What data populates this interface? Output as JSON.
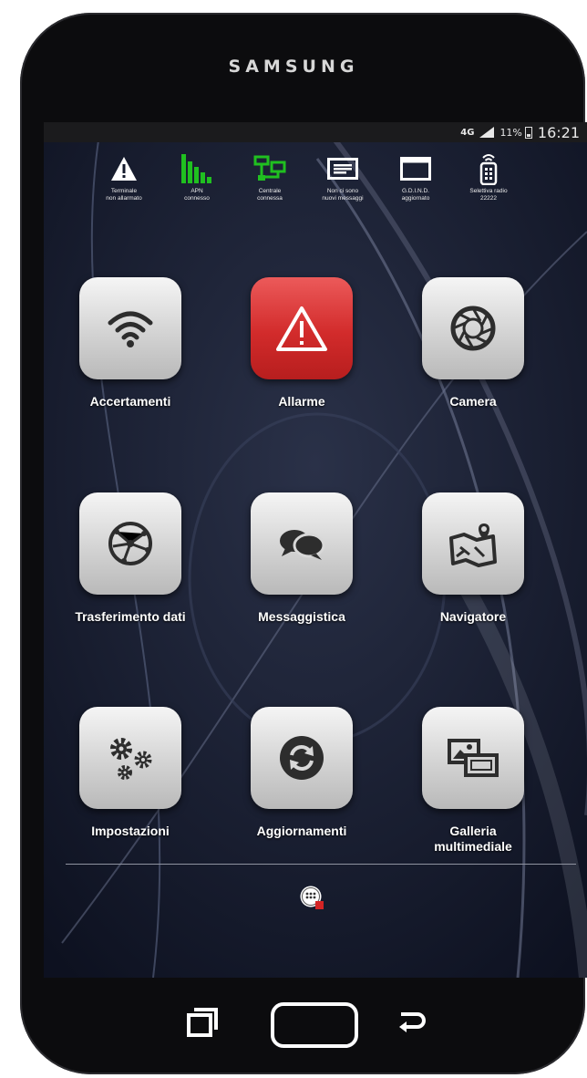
{
  "device": {
    "brand": "SAMSUNG"
  },
  "statusbar": {
    "network": "4G",
    "battery": "11%",
    "time": "16:21"
  },
  "status_indicators": [
    {
      "icon": "warning-icon",
      "label": "Terminale\nnon allarmato",
      "color": "#ffffff"
    },
    {
      "icon": "signal-bars-icon",
      "label": "APN\nconnesso",
      "color": "#20c020"
    },
    {
      "icon": "network-hub-icon",
      "label": "Centrale\nconnessa",
      "color": "#20c020"
    },
    {
      "icon": "message-icon",
      "label": "Non ci sono\nnuovi messaggi",
      "color": "#ffffff"
    },
    {
      "icon": "window-icon",
      "label": "G.D.I.N.D.\naggiornato",
      "color": "#ffffff"
    },
    {
      "icon": "radio-remote-icon",
      "label": "Selettiva radio\n22222",
      "color": "#ffffff"
    }
  ],
  "apps": [
    {
      "label": "Accertamenti",
      "icon": "wifi-icon"
    },
    {
      "label": "Allarme",
      "icon": "alert-triangle-icon"
    },
    {
      "label": "Camera",
      "icon": "camera-shutter-icon"
    },
    {
      "label": "Trasferimento dati",
      "icon": "globe-network-icon"
    },
    {
      "label": "Messaggistica",
      "icon": "chat-bubbles-icon"
    },
    {
      "label": "Navigatore",
      "icon": "map-pin-icon"
    },
    {
      "label": "Impostazioni",
      "icon": "gears-icon"
    },
    {
      "label": "Aggiornamenti",
      "icon": "refresh-icon"
    },
    {
      "label": "Galleria\nmultimediale",
      "icon": "gallery-icon"
    }
  ],
  "colors": {
    "alarm_tile": "#d22b2b",
    "connected": "#20c020"
  }
}
